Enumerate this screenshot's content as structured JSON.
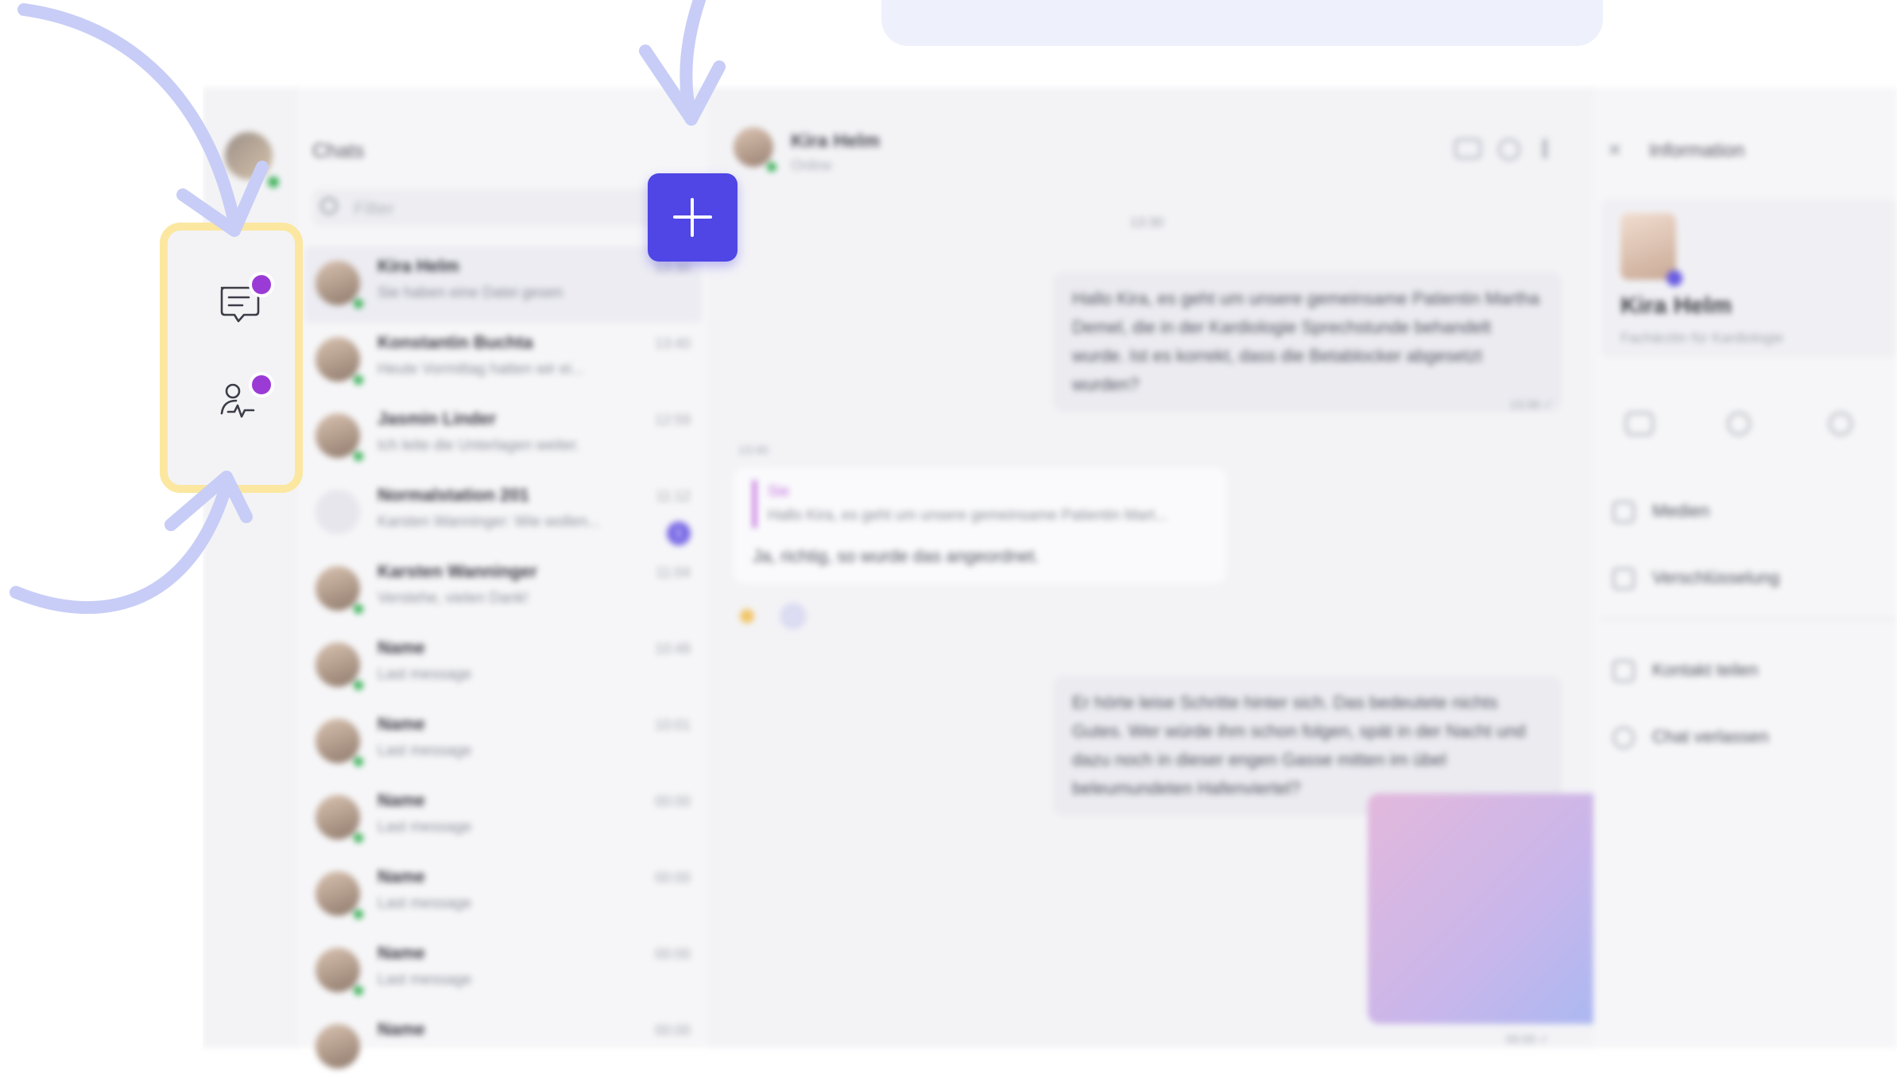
{
  "app": {
    "rail": {
      "chats_icon": "chat-bubble-icon",
      "patients_icon": "patient-monitor-icon"
    },
    "chatlist": {
      "title": "Chats",
      "filter_placeholder": "Filter",
      "items": [
        {
          "name": "Kira Helm",
          "message": "Sie haben eine Datei gesen",
          "time": "13:30",
          "active": true
        },
        {
          "name": "Konstantin Buchta",
          "message": "Heute Vormittag hatten wir ei...",
          "time": "13:40"
        },
        {
          "name": "Jasmin Linder",
          "message": "Ich leite die Unterlagen weiter.",
          "time": "12:59"
        },
        {
          "name": "Normalstation 201",
          "message": "Karsten Wanninger: Wie wollen...",
          "time": "11:12",
          "badge": "1"
        },
        {
          "name": "Karsten Wanninger",
          "message": "Verstehe, vielen Dank!",
          "time": "11:04"
        },
        {
          "name": "Name",
          "message": "Last message",
          "time": "10:48"
        },
        {
          "name": "Name",
          "message": "Last message",
          "time": "10:01"
        },
        {
          "name": "Name",
          "message": "Last message",
          "time": "00:00"
        },
        {
          "name": "Name",
          "message": "Last message",
          "time": "00:00"
        },
        {
          "name": "Name",
          "message": "Last message",
          "time": "00:00"
        },
        {
          "name": "Name",
          "message": "",
          "time": "00:00"
        }
      ]
    },
    "conversation": {
      "contact_name": "Kira Helm",
      "contact_status": "Online",
      "day_label": "13:30",
      "msg1": "Hallo Kira, es geht um unsere gemeinsame Patientin Martha Demel, die in der Kardiologie Sprechstunde behandelt wurde. Ist es korrekt, dass die Betablocker abgesetzt wurden?",
      "msg1_time": "13:39 ✓",
      "reply_time": "13:40",
      "quote_name": "Sie",
      "quote_text": "Hallo Kira, es geht um unsere gemeinsame Patientin Mart...",
      "reply_text": "Ja, richtig, so wurde das angeordnet.",
      "msg2": "Er hörte leise Schritte hinter sich. Das bedeutete nichts Gutes. Wer würde ihm schon folgen, spät in der Nacht und dazu noch in dieser engen Gasse mitten im übel beleumundeten Hafenviertel?",
      "media_time": "00:00 ✓"
    },
    "info": {
      "title": "Information",
      "name": "Kira Helm",
      "role": "Fachärztin für Kardiologie",
      "options": [
        "Medien",
        "Verschlüsselung",
        "Kontakt teilen",
        "Chat verlassen"
      ]
    }
  },
  "fab_icon": "plus-icon",
  "accent": "#4f46e5",
  "highlight_color": "#fbe7a0",
  "notification_color": "#9b3bd6",
  "arrow_color": "#c7cdf6"
}
